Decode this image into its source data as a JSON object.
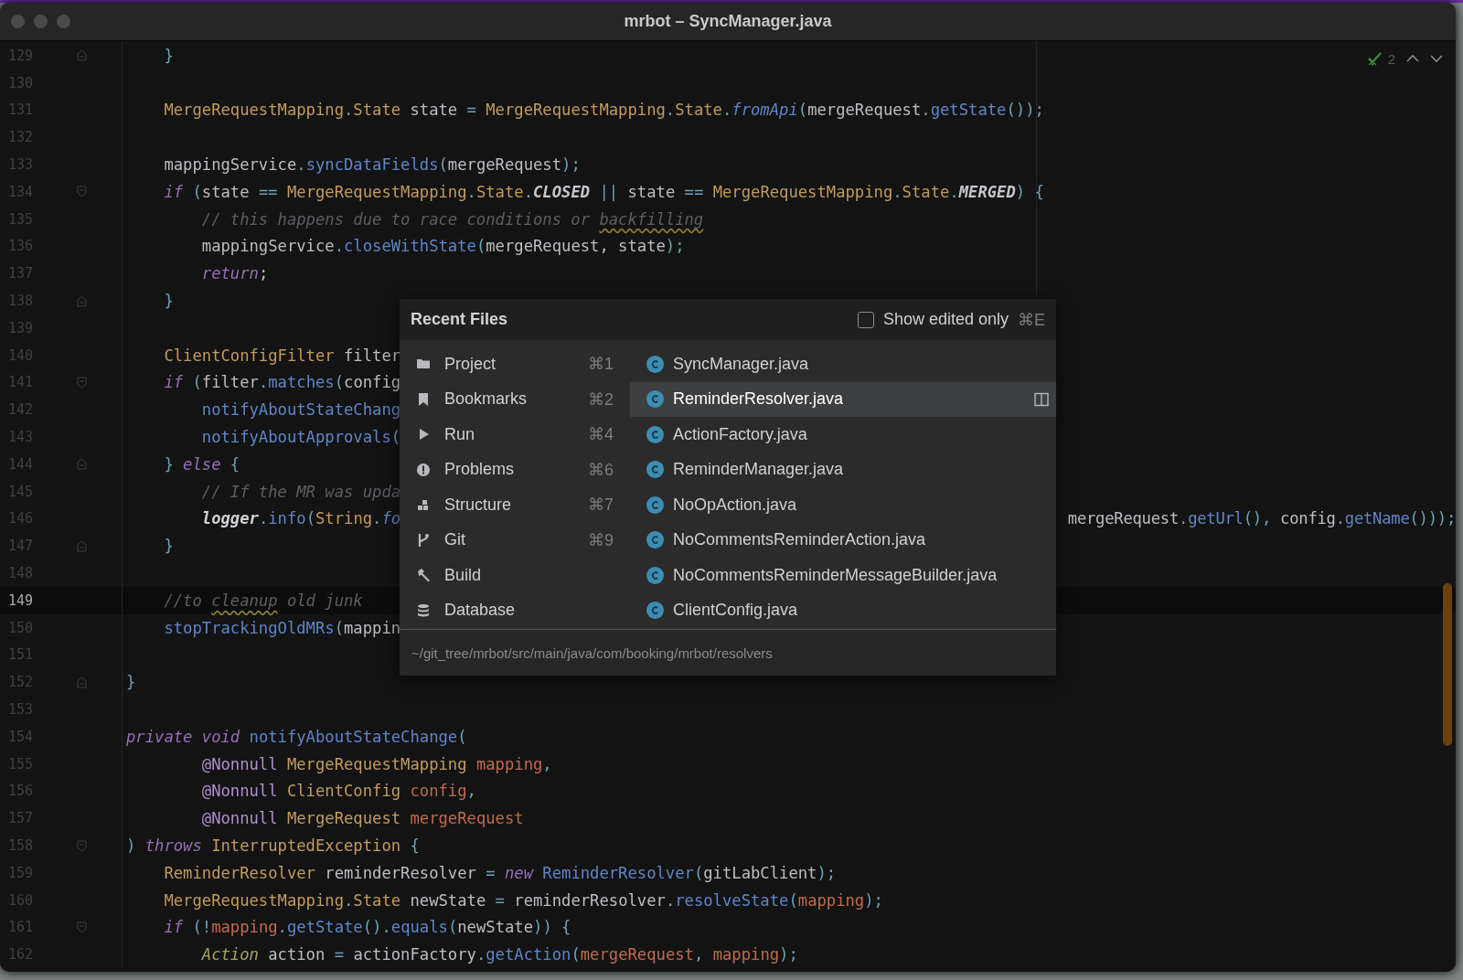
{
  "window": {
    "title": "mrbot – SyncManager.java"
  },
  "inspections": {
    "count": "2"
  },
  "editor": {
    "lines": [
      {
        "number": "129",
        "kind": "fold_end",
        "current": false,
        "tokens": [
          {
            "kind": "punct",
            "text": "    }"
          }
        ]
      },
      {
        "number": "130",
        "current": false
      },
      {
        "number": "131",
        "current": false,
        "tokens": [
          {
            "kind": "type",
            "text": "    MergeRequestMapping"
          },
          {
            "kind": "punct",
            "text": "."
          },
          {
            "kind": "type",
            "text": "State"
          },
          {
            "kind": "plain",
            "text": " state "
          },
          {
            "kind": "punct",
            "text": "= "
          },
          {
            "kind": "type",
            "text": "MergeRequestMapping"
          },
          {
            "kind": "punct",
            "text": "."
          },
          {
            "kind": "type",
            "text": "State"
          },
          {
            "kind": "punct",
            "text": "."
          },
          {
            "kind": "smethod",
            "text": "fromApi"
          },
          {
            "kind": "punct",
            "text": "("
          },
          {
            "kind": "plain",
            "text": "mergeRequest"
          },
          {
            "kind": "punct",
            "text": "."
          },
          {
            "kind": "method",
            "text": "getState"
          },
          {
            "kind": "punct",
            "text": "());"
          }
        ]
      },
      {
        "number": "132",
        "current": false
      },
      {
        "number": "133",
        "current": false,
        "tokens": [
          {
            "kind": "plain",
            "text": "    mappingService"
          },
          {
            "kind": "punct",
            "text": "."
          },
          {
            "kind": "method",
            "text": "syncDataFields"
          },
          {
            "kind": "punct",
            "text": "("
          },
          {
            "kind": "plain",
            "text": "mergeRequest"
          },
          {
            "kind": "punct",
            "text": ");"
          }
        ]
      },
      {
        "number": "134",
        "kind": "fold_start",
        "current": false,
        "tokens": [
          {
            "kind": "keyword",
            "text": "    if"
          },
          {
            "kind": "punct",
            "text": " ("
          },
          {
            "kind": "plain",
            "text": "state "
          },
          {
            "kind": "punct",
            "text": "== "
          },
          {
            "kind": "type",
            "text": "MergeRequestMapping"
          },
          {
            "kind": "punct",
            "text": "."
          },
          {
            "kind": "type",
            "text": "State"
          },
          {
            "kind": "punct",
            "text": "."
          },
          {
            "kind": "constant",
            "text": "CLOSED"
          },
          {
            "kind": "punct",
            "text": " ||"
          },
          {
            "kind": "plain",
            "text": " state "
          },
          {
            "kind": "punct",
            "text": "== "
          },
          {
            "kind": "type",
            "text": "MergeRequestMapping"
          },
          {
            "kind": "punct",
            "text": "."
          },
          {
            "kind": "type",
            "text": "State"
          },
          {
            "kind": "punct",
            "text": "."
          },
          {
            "kind": "constant",
            "text": "MERGED"
          },
          {
            "kind": "punct",
            "text": ") {"
          }
        ]
      },
      {
        "number": "135",
        "current": false,
        "tokens": [
          {
            "kind": "comment",
            "text": "        // this happens due to race conditions or "
          },
          {
            "kind": "typo",
            "text": "backfilling"
          }
        ]
      },
      {
        "number": "136",
        "current": false,
        "tokens": [
          {
            "kind": "plain",
            "text": "        mappingService"
          },
          {
            "kind": "punct",
            "text": "."
          },
          {
            "kind": "method",
            "text": "closeWithState"
          },
          {
            "kind": "punct",
            "text": "("
          },
          {
            "kind": "plain",
            "text": "mergeRequest, state"
          },
          {
            "kind": "punct",
            "text": ");"
          }
        ]
      },
      {
        "number": "137",
        "current": false,
        "tokens": [
          {
            "kind": "keyword",
            "text": "        return"
          },
          {
            "kind": "plain",
            "text": ";"
          }
        ]
      },
      {
        "number": "138",
        "kind": "fold_end",
        "current": false,
        "tokens": [
          {
            "kind": "punct",
            "text": "    }"
          }
        ]
      },
      {
        "number": "139",
        "current": false
      },
      {
        "number": "140",
        "current": false,
        "tokens": [
          {
            "kind": "type",
            "text": "    ClientConfigFilter"
          },
          {
            "kind": "plain",
            "text": " filter"
          }
        ]
      },
      {
        "number": "141",
        "kind": "fold_start",
        "current": false,
        "tokens": [
          {
            "kind": "keyword",
            "text": "    if"
          },
          {
            "kind": "punct",
            "text": " ("
          },
          {
            "kind": "plain",
            "text": "filter"
          },
          {
            "kind": "punct",
            "text": "."
          },
          {
            "kind": "method",
            "text": "matches"
          },
          {
            "kind": "punct",
            "text": "("
          },
          {
            "kind": "plain",
            "text": "config"
          }
        ]
      },
      {
        "number": "142",
        "current": false,
        "tokens": [
          {
            "kind": "method",
            "text": "        notifyAboutStateChang"
          }
        ]
      },
      {
        "number": "143",
        "current": false,
        "tokens": [
          {
            "kind": "method",
            "text": "        notifyAboutApprovals"
          },
          {
            "kind": "punct",
            "text": "("
          }
        ]
      },
      {
        "number": "144",
        "kind": "fold_both",
        "current": false,
        "tokens": [
          {
            "kind": "punct",
            "text": "    } "
          },
          {
            "kind": "keyword",
            "text": "else"
          },
          {
            "kind": "punct",
            "text": " {"
          }
        ]
      },
      {
        "number": "145",
        "current": false,
        "tokens": [
          {
            "kind": "comment",
            "text": "        // If the MR was upda"
          }
        ]
      },
      {
        "number": "146",
        "current": false,
        "tokens": [
          {
            "kind": "field",
            "text": "        logger"
          },
          {
            "kind": "punct",
            "text": "."
          },
          {
            "kind": "method",
            "text": "info"
          },
          {
            "kind": "punct",
            "text": "("
          },
          {
            "kind": "type",
            "text": "String"
          },
          {
            "kind": "punct",
            "text": "."
          },
          {
            "kind": "smethod",
            "text": "fo"
          }
        ],
        "tail": [
          {
            "kind": "plain",
            "text": "mergeRequest"
          },
          {
            "kind": "punct",
            "text": "."
          },
          {
            "kind": "method",
            "text": "getUrl"
          },
          {
            "kind": "punct",
            "text": "(),"
          },
          {
            "kind": "plain",
            "text": " config"
          },
          {
            "kind": "punct",
            "text": "."
          },
          {
            "kind": "method",
            "text": "getName"
          },
          {
            "kind": "punct",
            "text": "()));"
          }
        ]
      },
      {
        "number": "147",
        "kind": "fold_end",
        "current": false,
        "tokens": [
          {
            "kind": "punct",
            "text": "    }"
          }
        ]
      },
      {
        "number": "148",
        "current": false
      },
      {
        "number": "149",
        "current": true,
        "tokens": [
          {
            "kind": "comment",
            "text": "    //to "
          },
          {
            "kind": "typo",
            "text": "cleanup"
          },
          {
            "kind": "comment",
            "text": " old junk"
          }
        ]
      },
      {
        "number": "150",
        "current": false,
        "tokens": [
          {
            "kind": "method",
            "text": "    stopTrackingOldMRs"
          },
          {
            "kind": "punct",
            "text": "("
          },
          {
            "kind": "plain",
            "text": "mappin"
          }
        ]
      },
      {
        "number": "151",
        "current": false
      },
      {
        "number": "152",
        "kind": "fold_end",
        "current": false,
        "tokens": [
          {
            "kind": "punct",
            "text": "}"
          }
        ]
      },
      {
        "number": "153",
        "current": false
      },
      {
        "number": "154",
        "current": false,
        "tokens": [
          {
            "kind": "keyword",
            "text": "private void"
          },
          {
            "kind": "method",
            "text": " notifyAboutStateChange"
          },
          {
            "kind": "punct",
            "text": "("
          }
        ]
      },
      {
        "number": "155",
        "current": false,
        "tokens": [
          {
            "kind": "annotation",
            "text": "        @Nonnull"
          },
          {
            "kind": "type",
            "text": " MergeRequestMapping"
          },
          {
            "kind": "param",
            "text": " mapping"
          },
          {
            "kind": "punct",
            "text": ","
          }
        ]
      },
      {
        "number": "156",
        "current": false,
        "tokens": [
          {
            "kind": "annotation",
            "text": "        @Nonnull"
          },
          {
            "kind": "type",
            "text": " ClientConfig"
          },
          {
            "kind": "param",
            "text": " config"
          },
          {
            "kind": "punct",
            "text": ","
          }
        ]
      },
      {
        "number": "157",
        "current": false,
        "tokens": [
          {
            "kind": "annotation",
            "text": "        @Nonnull"
          },
          {
            "kind": "type",
            "text": " MergeRequest"
          },
          {
            "kind": "param",
            "text": " mergeRequest"
          }
        ]
      },
      {
        "number": "158",
        "kind": "fold_start",
        "current": false,
        "tokens": [
          {
            "kind": "punct",
            "text": ")"
          },
          {
            "kind": "keyword",
            "text": " throws"
          },
          {
            "kind": "type",
            "text": " InterruptedException"
          },
          {
            "kind": "punct",
            "text": " {"
          }
        ]
      },
      {
        "number": "159",
        "current": false,
        "tokens": [
          {
            "kind": "type",
            "text": "    ReminderResolver"
          },
          {
            "kind": "plain",
            "text": " reminderResolver "
          },
          {
            "kind": "punct",
            "text": "= "
          },
          {
            "kind": "keyword",
            "text": "new"
          },
          {
            "kind": "method",
            "text": " ReminderResolver"
          },
          {
            "kind": "punct",
            "text": "("
          },
          {
            "kind": "plain",
            "text": "gitLabClient"
          },
          {
            "kind": "punct",
            "text": ");"
          }
        ]
      },
      {
        "number": "160",
        "current": false,
        "tokens": [
          {
            "kind": "type",
            "text": "    MergeRequestMapping"
          },
          {
            "kind": "punct",
            "text": "."
          },
          {
            "kind": "type",
            "text": "State"
          },
          {
            "kind": "plain",
            "text": " newState "
          },
          {
            "kind": "punct",
            "text": "="
          },
          {
            "kind": "plain",
            "text": " reminderResolver"
          },
          {
            "kind": "punct",
            "text": "."
          },
          {
            "kind": "method",
            "text": "resolveState"
          },
          {
            "kind": "punct",
            "text": "("
          },
          {
            "kind": "param",
            "text": "mapping"
          },
          {
            "kind": "punct",
            "text": ");"
          }
        ]
      },
      {
        "number": "161",
        "kind": "fold_start",
        "current": false,
        "tokens": [
          {
            "kind": "keyword",
            "text": "    if"
          },
          {
            "kind": "punct",
            "text": " (!"
          },
          {
            "kind": "param",
            "text": "mapping"
          },
          {
            "kind": "punct",
            "text": "."
          },
          {
            "kind": "method",
            "text": "getState"
          },
          {
            "kind": "punct",
            "text": "()."
          },
          {
            "kind": "method",
            "text": "equals"
          },
          {
            "kind": "punct",
            "text": "("
          },
          {
            "kind": "plain",
            "text": "newState"
          },
          {
            "kind": "punct",
            "text": ")) {"
          }
        ]
      },
      {
        "number": "162",
        "current": false,
        "tokens": [
          {
            "kind": "interface",
            "text": "        Action"
          },
          {
            "kind": "plain",
            "text": " action "
          },
          {
            "kind": "punct",
            "text": "="
          },
          {
            "kind": "plain",
            "text": " actionFactory"
          },
          {
            "kind": "punct",
            "text": "."
          },
          {
            "kind": "method",
            "text": "getAction"
          },
          {
            "kind": "punct",
            "text": "("
          },
          {
            "kind": "param",
            "text": "mergeRequest"
          },
          {
            "kind": "punct",
            "text": ", "
          },
          {
            "kind": "param",
            "text": "mapping"
          },
          {
            "kind": "punct",
            "text": ");"
          }
        ]
      }
    ]
  },
  "recent_files": {
    "title": "Recent Files",
    "show_edited": {
      "label": "Show edited only",
      "shortcut": "⌘E",
      "checked": false
    },
    "tool_windows": [
      {
        "kind": "project",
        "label": "Project",
        "shortcut": "⌘1"
      },
      {
        "kind": "bookmarks",
        "label": "Bookmarks",
        "shortcut": "⌘2"
      },
      {
        "kind": "run",
        "label": "Run",
        "shortcut": "⌘4"
      },
      {
        "kind": "problems",
        "label": "Problems",
        "shortcut": "⌘6"
      },
      {
        "kind": "structure",
        "label": "Structure",
        "shortcut": "⌘7"
      },
      {
        "kind": "git",
        "label": "Git",
        "shortcut": "⌘9"
      },
      {
        "kind": "build",
        "label": "Build"
      },
      {
        "kind": "database",
        "label": "Database"
      }
    ],
    "files": [
      {
        "name": "SyncManager.java",
        "selected": false
      },
      {
        "name": "ReminderResolver.java",
        "selected": true
      },
      {
        "name": "ActionFactory.java",
        "selected": false
      },
      {
        "name": "ReminderManager.java",
        "selected": false
      },
      {
        "name": "NoOpAction.java",
        "selected": false
      },
      {
        "name": "NoCommentsReminderAction.java",
        "selected": false
      },
      {
        "name": "NoCommentsReminderMessageBuilder.java",
        "selected": false
      },
      {
        "name": "ClientConfig.java",
        "selected": false
      }
    ],
    "path": "~/git_tree/mrbot/src/main/java/com/booking/mrbot/resolvers"
  }
}
